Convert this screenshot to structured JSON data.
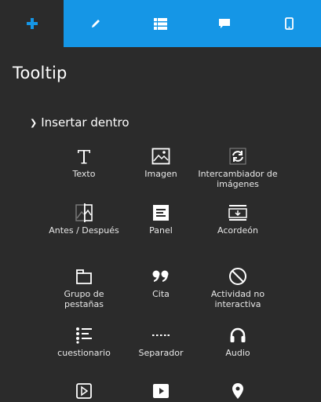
{
  "tabs": [
    {
      "name": "add",
      "icon": "plus-icon",
      "active": true
    },
    {
      "name": "edit",
      "icon": "pencil-icon",
      "active": false
    },
    {
      "name": "list",
      "icon": "list-icon",
      "active": false
    },
    {
      "name": "comment",
      "icon": "comment-icon",
      "active": false
    },
    {
      "name": "mobile",
      "icon": "mobile-icon",
      "active": false
    }
  ],
  "panel": {
    "title": "Tooltip",
    "section_label": "Insertar dentro"
  },
  "items": [
    {
      "label": "Texto",
      "icon": "text-icon"
    },
    {
      "label": "Imagen",
      "icon": "image-icon"
    },
    {
      "label": "Intercambiador de imágenes",
      "icon": "image-swap-icon"
    },
    {
      "label": "Antes / Después",
      "icon": "before-after-icon"
    },
    {
      "label": "Panel",
      "icon": "panel-icon"
    },
    {
      "label": "Acordeón",
      "icon": "accordion-icon"
    },
    {
      "label": "Grupo de pestañas",
      "icon": "tab-group-icon"
    },
    {
      "label": "Cita",
      "icon": "quote-icon"
    },
    {
      "label": "Actividad no interactiva",
      "icon": "no-interaction-icon"
    },
    {
      "label": "cuestionario",
      "icon": "questionnaire-icon"
    },
    {
      "label": "Separador",
      "icon": "separator-icon"
    },
    {
      "label": "Audio",
      "icon": "headphones-icon"
    },
    {
      "label": "",
      "icon": "video-icon"
    },
    {
      "label": "",
      "icon": "play-icon"
    },
    {
      "label": "",
      "icon": "map-pin-icon"
    }
  ],
  "colors": {
    "tab_bar": "#1596e6",
    "panel_bg": "#2b2b2b",
    "text": "#ffffff"
  }
}
